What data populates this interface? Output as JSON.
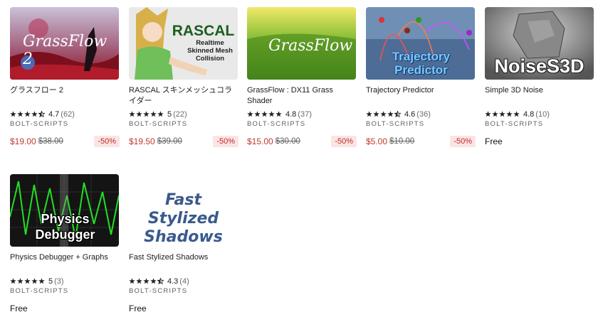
{
  "products": [
    {
      "title": "グラスフロー 2",
      "rating": "4.7",
      "reviews": "(62)",
      "stars": 4.5,
      "publisher": "BOLT-SCRIPTS",
      "price": "$19.00",
      "original_price": "$38.00",
      "discount": "-50%",
      "thumb_text": "GrassFlow 2"
    },
    {
      "title": "RASCAL スキンメッシュコライダー",
      "rating": "5",
      "reviews": "(22)",
      "stars": 5,
      "publisher": "BOLT-SCRIPTS",
      "price": "$19.50",
      "original_price": "$39.00",
      "discount": "-50%",
      "thumb_text": "RASCAL",
      "thumb_subtext": "Realtime Skinned Mesh Collision"
    },
    {
      "title": "GrassFlow : DX11 Grass Shader",
      "rating": "4.8",
      "reviews": "(37)",
      "stars": 5,
      "publisher": "BOLT-SCRIPTS",
      "price": "$15.00",
      "original_price": "$30.00",
      "discount": "-50%",
      "thumb_text": "GrassFlow"
    },
    {
      "title": "Trajectory Predictor",
      "rating": "4.6",
      "reviews": "(36)",
      "stars": 4.5,
      "publisher": "BOLT-SCRIPTS",
      "price": "$5.00",
      "original_price": "$10.00",
      "discount": "-50%",
      "thumb_text": "Trajectory Predictor"
    },
    {
      "title": "Simple 3D Noise",
      "rating": "4.8",
      "reviews": "(10)",
      "stars": 5,
      "publisher": "BOLT-SCRIPTS",
      "price": "Free",
      "thumb_text": "NoiseS3D"
    },
    {
      "title": "Physics Debugger + Graphs",
      "rating": "5",
      "reviews": "(3)",
      "stars": 5,
      "publisher": "BOLT-SCRIPTS",
      "price": "Free",
      "thumb_text": "Physics Debugger"
    },
    {
      "title": "Fast Stylized Shadows",
      "rating": "4.3",
      "reviews": "(4)",
      "stars": 4.5,
      "publisher": "BOLT-SCRIPTS",
      "price": "Free",
      "thumb_text": "Fast Stylized Shadows"
    }
  ]
}
